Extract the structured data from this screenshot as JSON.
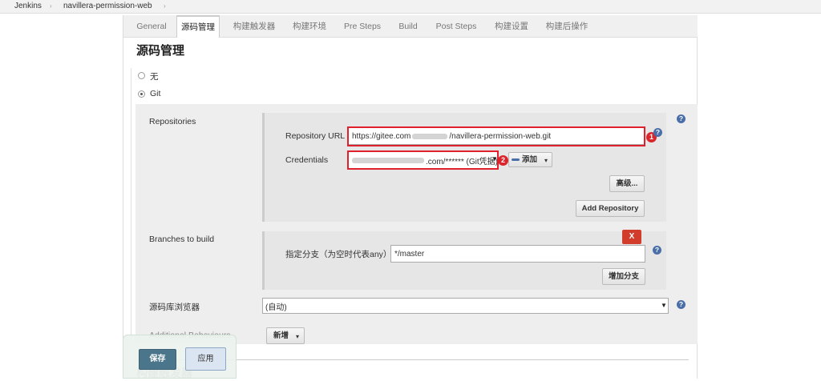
{
  "breadcrumb": {
    "items": [
      "Jenkins",
      "navillera-permission-web"
    ],
    "separator": "›"
  },
  "tabs": [
    {
      "label": "General"
    },
    {
      "label": "源码管理"
    },
    {
      "label": "构建触发器"
    },
    {
      "label": "构建环境"
    },
    {
      "label": "Pre Steps"
    },
    {
      "label": "Build"
    },
    {
      "label": "Post Steps"
    },
    {
      "label": "构建设置"
    },
    {
      "label": "构建后操作"
    }
  ],
  "active_tab": "源码管理",
  "section_title": "源码管理",
  "scm_options": [
    {
      "label": "无",
      "checked": false
    },
    {
      "label": "Git",
      "checked": true
    }
  ],
  "repositories": {
    "label": "Repositories",
    "url_label": "Repository URL",
    "url_prefix": "https://gitee.com",
    "url_suffix": "/navillera-permission-web.git",
    "credentials_label": "Credentials",
    "credentials_suffix": ".com/****** (Git凭据)",
    "add_button": "添加",
    "advanced_button": "高级...",
    "add_repository_button": "Add Repository"
  },
  "branches": {
    "label": "Branches to build",
    "delete_button": "X",
    "spec_label": "指定分支（为空时代表any）",
    "spec_value": "*/master",
    "add_branch_button": "增加分支"
  },
  "browser": {
    "label": "源码库浏览器",
    "value": "(自动)"
  },
  "additional": {
    "label": "Additional Behaviours",
    "add_button": "新增"
  },
  "next_section_partial": "构建触发器",
  "annotations": {
    "badge1": "1",
    "badge2": "2"
  },
  "actions": {
    "save": "保存",
    "apply": "应用"
  },
  "icons": {
    "help": "?",
    "dropdown": "▼",
    "small_caret": "▾"
  },
  "colors": {
    "highlight_red": "#e0202c",
    "help_blue": "#4a6ea9",
    "save_blue": "#4b758b",
    "delete_red": "#d23d2b"
  }
}
